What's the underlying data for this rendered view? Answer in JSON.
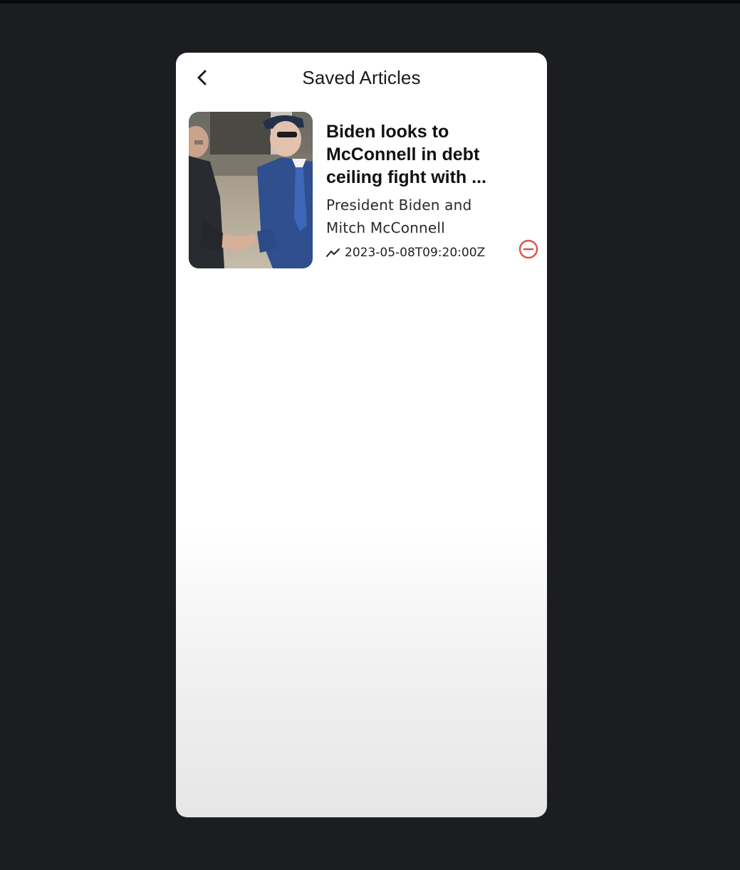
{
  "header": {
    "title": "Saved Articles",
    "back_icon": "chevron-left-icon"
  },
  "articles": [
    {
      "title_lines": [
        "Biden looks to",
        "McConnell in debt",
        "ceiling fight with ..."
      ],
      "summary_lines": [
        "President Biden and",
        "Mitch McConnell"
      ],
      "date": "2023-05-08T09:20:00Z",
      "date_icon": "trending-icon",
      "remove_icon": "minus-circle-icon"
    }
  ],
  "colors": {
    "background": "#1c1d20",
    "card": "#ffffff",
    "title_text": "#111111",
    "remove_accent": "#d9534f"
  }
}
